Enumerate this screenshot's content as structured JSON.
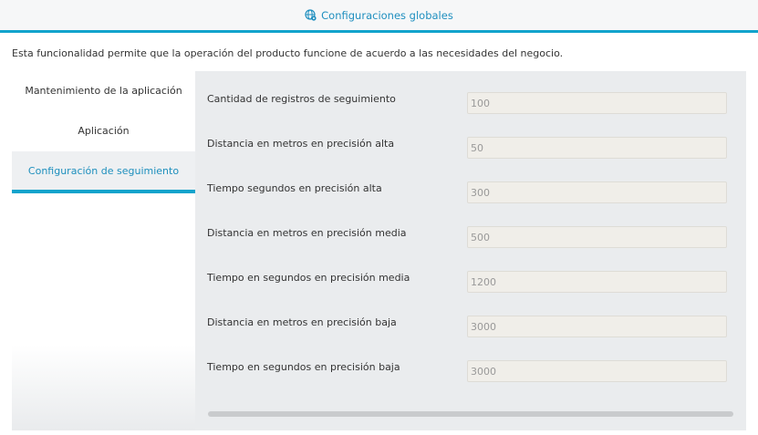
{
  "header": {
    "title": "Configuraciones globales",
    "icon": "globe-gear-icon"
  },
  "colors": {
    "accent": "#11a3cc",
    "link_text": "#1d8fbd"
  },
  "description": "Esta funcionalidad permite que la operación del producto funcione de acuerdo a las necesidades del negocio.",
  "sidebar": {
    "items": [
      {
        "label": "Mantenimiento de la aplicación",
        "active": false
      },
      {
        "label": "Aplicación",
        "active": false
      },
      {
        "label": "Configuración de seguimiento",
        "active": true
      }
    ]
  },
  "form": {
    "rows": [
      {
        "label": "Cantidad de registros de seguimiento",
        "value": "100"
      },
      {
        "label": "Distancia en metros en precisión alta",
        "value": "50"
      },
      {
        "label": "Tiempo segundos en precisión alta",
        "value": "300"
      },
      {
        "label": "Distancia en metros en precisión media",
        "value": "500"
      },
      {
        "label": "Tiempo en segundos en precisión media",
        "value": "1200"
      },
      {
        "label": "Distancia en metros en precisión baja",
        "value": "3000"
      },
      {
        "label": "Tiempo en segundos en precisión baja",
        "value": "3000"
      }
    ]
  }
}
